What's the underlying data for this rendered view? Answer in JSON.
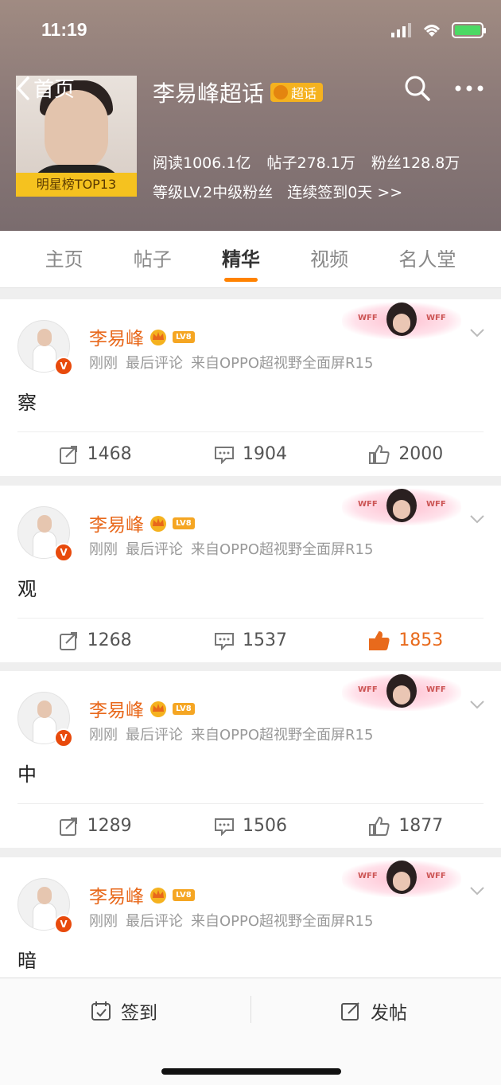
{
  "status": {
    "time": "11:19"
  },
  "header": {
    "back_label": "首页",
    "title": "李易峰超话",
    "badge": "超话",
    "rank_badge": "明星榜TOP13",
    "stats": {
      "reads": "阅读1006.1亿",
      "posts": "帖子278.1万",
      "fans": "粉丝128.8万"
    },
    "level": "等级LV.2中级粉丝",
    "checkin": "连续签到0天 >>"
  },
  "tabs": [
    "主页",
    "帖子",
    "精华",
    "视频",
    "名人堂"
  ],
  "active_tab": 2,
  "posts": [
    {
      "name": "李易峰",
      "lv": "LV8",
      "time": "刚刚",
      "meta": "最后评论",
      "source": "来自OPPO超视野全面屏R15",
      "text": "察",
      "reposts": "1468",
      "comments": "1904",
      "likes": "2000",
      "liked": false
    },
    {
      "name": "李易峰",
      "lv": "LV8",
      "time": "刚刚",
      "meta": "最后评论",
      "source": "来自OPPO超视野全面屏R15",
      "text": "观",
      "reposts": "1268",
      "comments": "1537",
      "likes": "1853",
      "liked": true
    },
    {
      "name": "李易峰",
      "lv": "LV8",
      "time": "刚刚",
      "meta": "最后评论",
      "source": "来自OPPO超视野全面屏R15",
      "text": "中",
      "reposts": "1289",
      "comments": "1506",
      "likes": "1877",
      "liked": false
    },
    {
      "name": "李易峰",
      "lv": "LV8",
      "time": "刚刚",
      "meta": "最后评论",
      "source": "来自OPPO超视野全面屏R15",
      "text": "暗"
    }
  ],
  "decor_tag": "WFF",
  "bottom_bar": {
    "checkin_label": "签到",
    "post_label": "发帖"
  },
  "colors": {
    "accent": "#ff8200",
    "name": "#e8681b",
    "liked": "#e86a1c"
  }
}
